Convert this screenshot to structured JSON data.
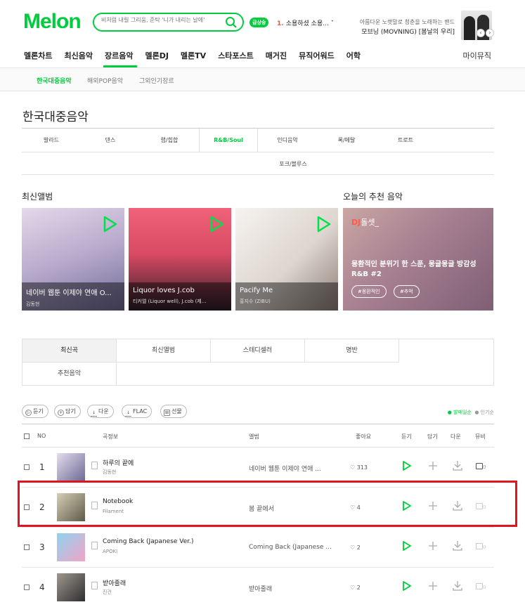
{
  "header": {
    "logo": "Melon",
    "search_placeholder": "비처럼 내릴 그리움, 준탁 '니가 내리는 날에'",
    "live_badge": "급상승",
    "live_rank": "1.",
    "live_text": "소용하셨 소용... ˇ",
    "ad_line1": "아름다운 노랫말로 청춘을 노래하는 밴드",
    "ad_line2": "모브닝 (MOVNING) [봄날의 우리]",
    "ad_prev": "‹",
    "ad_next": "›"
  },
  "gnb": {
    "items": [
      "멜론차트",
      "최신음악",
      "장르음악",
      "멜론DJ",
      "멜론TV",
      "스타포스트",
      "매거진",
      "뮤직어워드",
      "어학"
    ],
    "mymusic": "마이뮤직"
  },
  "subnav": [
    "한국대중음악",
    "해외POP음악",
    "그외인기장르"
  ],
  "page_title": "한국대중음악",
  "genres": [
    "발라드",
    "댄스",
    "랩/힙합",
    "R&B/Soul",
    "인디음악",
    "록/메탈",
    "트로트",
    "포크/블루스"
  ],
  "new_albums": {
    "title": "최신앨범",
    "items": [
      {
        "title": "네이버 웹툰 이제야 연애 O...",
        "artist": "김동현",
        "bg1": "#d6c3dc",
        "bg2": "#8b86a9"
      },
      {
        "title": "Liquor loves J.cob",
        "artist": "티커엘 (Liquor well), J.cob (제...",
        "bg1": "#e8556a",
        "bg2": "#3a2430"
      },
      {
        "title": "Pacify Me",
        "artist": "홍지수 (ZIBU)",
        "bg1": "#f2eeeb",
        "bg2": "#bfb6ae"
      }
    ]
  },
  "reco": {
    "title": "오늘의 추천 음악",
    "tag_accent": "DJ",
    "tag_rest": "돌셋_",
    "desc1": "몽환적인 분위기 한 스푼, 몽글몽글 방감성",
    "desc2": "R&B #2",
    "chips": [
      "#몽환적인",
      "#추억"
    ]
  },
  "list_tabs": [
    "최신곡",
    "최신앨범",
    "스테디셀러",
    "명반",
    "추천음악"
  ],
  "toolbar": {
    "buttons": [
      "듣기",
      "담기",
      "다운",
      "FLAC",
      "선물"
    ],
    "sort_on": "● 발매일순",
    "sort_off": "● 인기순"
  },
  "table": {
    "headers": [
      "NO",
      "곡정보",
      "앨범",
      "좋아요",
      "듣기",
      "담기",
      "다운",
      "뮤비"
    ],
    "rows": [
      {
        "rank": "1",
        "song": "하루의 끝에",
        "artist": "김동현",
        "album": "네이버 웹툰 이제야 연애 ...",
        "likes": "313",
        "mv": "0",
        "c1": "#d9cfe6",
        "c2": "#6d6a94"
      },
      {
        "rank": "2",
        "song": "Notebook",
        "artist": "Filament",
        "album": "봄 끝에서",
        "likes": "4",
        "mv": "0",
        "c1": "#c9c2a6",
        "c2": "#5e5a49"
      },
      {
        "rank": "3",
        "song": "Coming Back (Japanese Ver.)",
        "artist": "APOKI",
        "album": "Coming Back (Japanese ...",
        "likes": "2",
        "mv": "0",
        "c1": "#8fd3f0",
        "c2": "#f2a3c6"
      },
      {
        "rank": "4",
        "song": "받아줄래",
        "artist": "진건",
        "album": "받아줄래",
        "likes": "2",
        "mv": "0",
        "c1": "#3a3a3a",
        "c2": "#a09890"
      }
    ]
  },
  "colors": {
    "accent": "#00cd3c",
    "highlight": "#e0141e"
  }
}
